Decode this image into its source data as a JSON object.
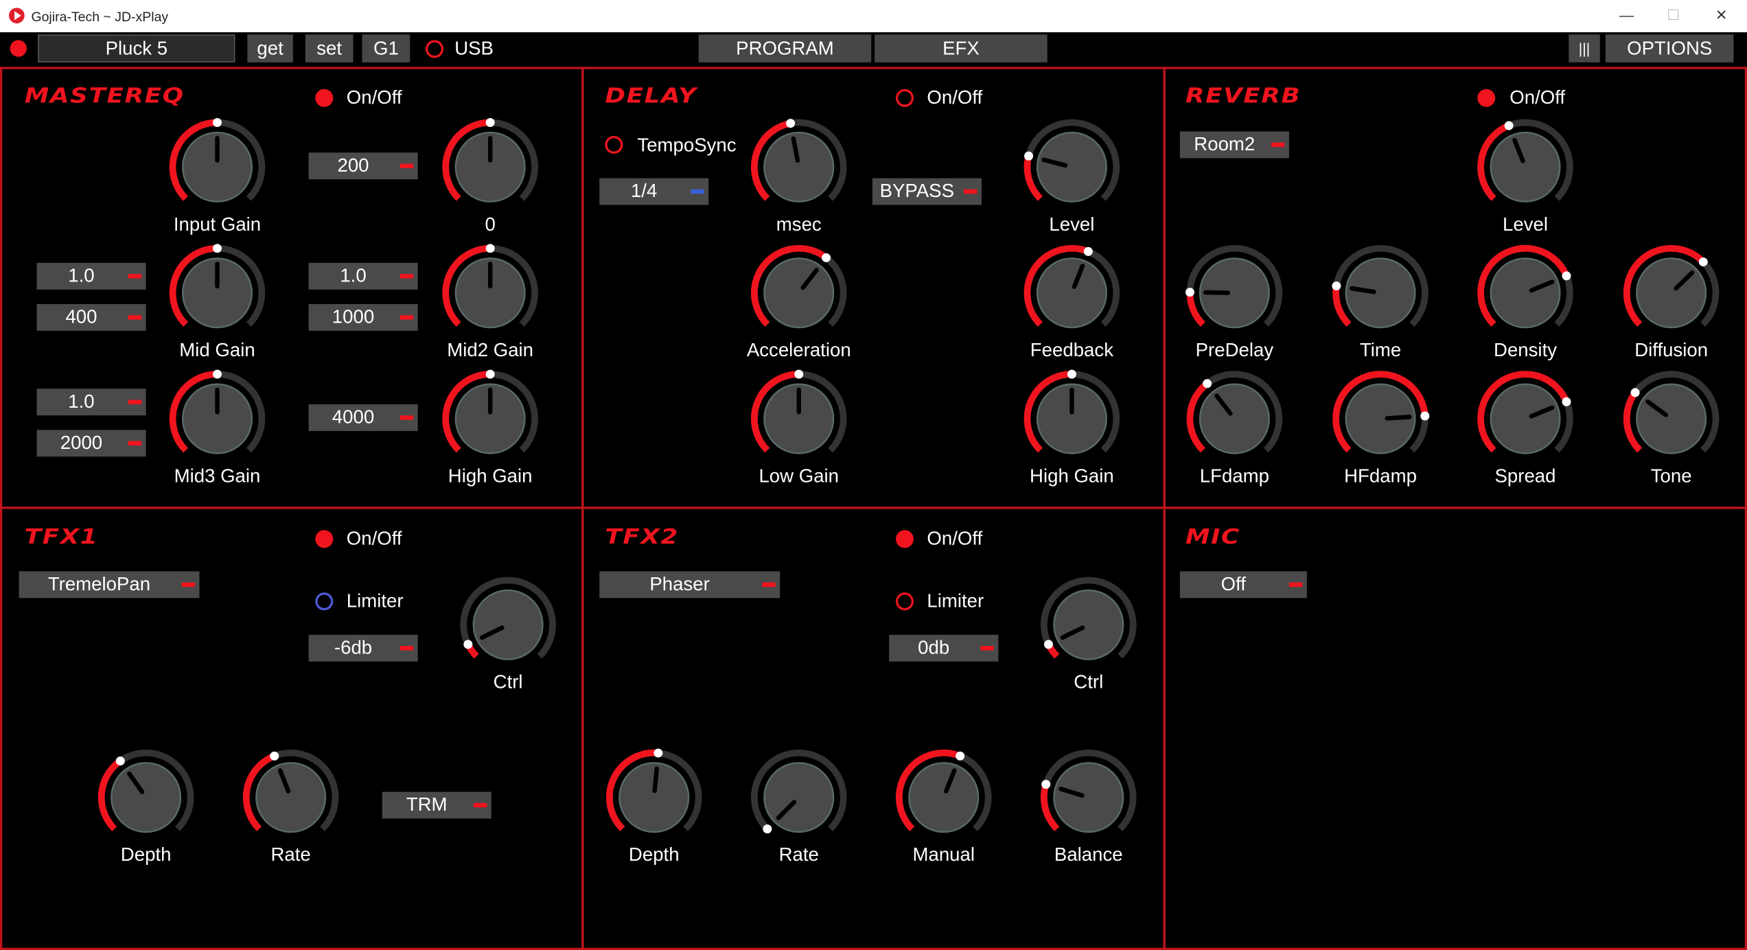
{
  "window": {
    "app": "Gojira-Tech",
    "title": "~ JD-xPlay",
    "minimize": "—",
    "maximize": "☐",
    "close": "✕"
  },
  "topbar": {
    "preset": "Pluck 5",
    "get": "get",
    "set": "set",
    "g1": "G1",
    "usb": "USB",
    "program": "PROGRAM",
    "efx": "EFX",
    "menu_icon": "|||",
    "options": "OPTIONS"
  },
  "colors": {
    "accent": "#f0141e",
    "panel_border": "#c0141c",
    "knob_track": "#333333",
    "knob_body": "#4a4a4a",
    "field": "#4a4a4a",
    "blue": "#3b5fd6"
  },
  "mastereq": {
    "title": "MASTEREQ",
    "onoff_label": "On/Off",
    "onoff": true,
    "fields": {
      "f_input_freq": "200",
      "f_mid_q": "1.0",
      "f_mid_freq": "400",
      "f_mid2_q": "1.0",
      "f_mid2_freq": "1000",
      "f_mid3_q": "1.0",
      "f_mid3_freq": "2000",
      "f_high_freq": "4000"
    },
    "knobs": {
      "input_gain": "Input Gain",
      "input_value": "0",
      "mid_gain": "Mid Gain",
      "mid2_gain": "Mid2 Gain",
      "mid3_gain": "Mid3 Gain",
      "high_gain": "High Gain"
    }
  },
  "delay": {
    "title": "DELAY",
    "onoff_label": "On/Off",
    "onoff": false,
    "temposync_label": "TempoSync",
    "temposync": false,
    "note_value": "1/4",
    "bypass": "BYPASS",
    "knobs": {
      "msec": "msec",
      "level": "Level",
      "acceleration": "Acceleration",
      "feedback": "Feedback",
      "low_gain": "Low Gain",
      "high_gain": "High Gain"
    }
  },
  "reverb": {
    "title": "REVERB",
    "onoff_label": "On/Off",
    "onoff": true,
    "type": "Room2",
    "knobs": {
      "level": "Level",
      "predelay": "PreDelay",
      "time": "Time",
      "density": "Density",
      "diffusion": "Diffusion",
      "lfdamp": "LFdamp",
      "hfdamp": "HFdamp",
      "spread": "Spread",
      "tone": "Tone"
    }
  },
  "tfx1": {
    "title": "TFX1",
    "onoff_label": "On/Off",
    "onoff": true,
    "type": "TremeloPan",
    "limiter_label": "Limiter",
    "limiter": false,
    "limiter_db": "-6db",
    "mode": "TRM",
    "knobs": {
      "ctrl": "Ctrl",
      "depth": "Depth",
      "rate": "Rate"
    }
  },
  "tfx2": {
    "title": "TFX2",
    "onoff_label": "On/Off",
    "onoff": true,
    "type": "Phaser",
    "limiter_label": "Limiter",
    "limiter": false,
    "limiter_db": "0db",
    "knobs": {
      "ctrl": "Ctrl",
      "depth": "Depth",
      "rate": "Rate",
      "manual": "Manual",
      "balance": "Balance"
    }
  },
  "mic": {
    "title": "MIC",
    "value": "Off"
  },
  "knob_levels": {
    "eq_input": 0.5,
    "eq_input2": 0.5,
    "eq_mid": 0.5,
    "eq_mid2": 0.5,
    "eq_mid3": 0.5,
    "eq_high": 0.5,
    "dl_msec": 0.46,
    "dl_level": 0.22,
    "dl_accel": 0.64,
    "dl_feedback": 0.58,
    "dl_low": 0.5,
    "dl_high": 0.5,
    "rv_level": 0.42,
    "rv_predelay": 0.17,
    "rv_time": 0.2,
    "rv_density": 0.75,
    "rv_diffusion": 0.67,
    "rv_lfdamp": 0.36,
    "rv_hfdamp": 0.82,
    "rv_spread": 0.75,
    "rv_tone": 0.3,
    "t1_ctrl": 0.07,
    "t1_depth": 0.37,
    "t1_rate": 0.42,
    "t2_ctrl": 0.07,
    "t2_depth": 0.52,
    "t2_rate": 0.0,
    "t2_manual": 0.58,
    "t2_balance": 0.23
  }
}
